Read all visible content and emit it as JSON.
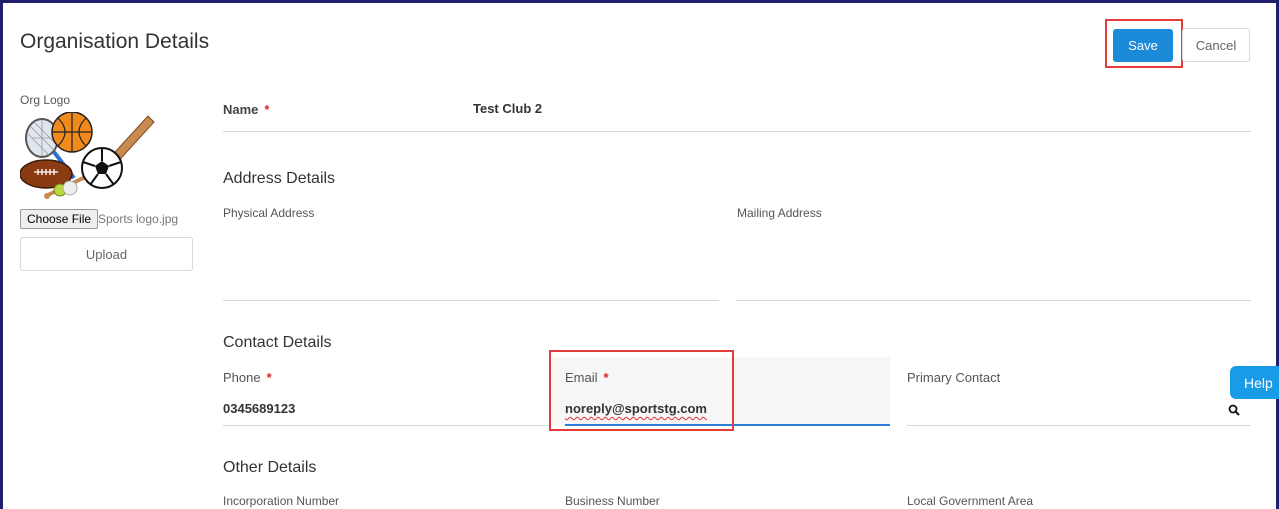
{
  "header": {
    "title": "Organisation Details",
    "save_label": "Save",
    "cancel_label": "Cancel"
  },
  "logo": {
    "label": "Org Logo",
    "choose_file_label": "Choose File",
    "file_name": "Sports logo.jpg",
    "upload_label": "Upload"
  },
  "name": {
    "label": "Name",
    "required_mark": "*",
    "value": "Test Club 2"
  },
  "address": {
    "section_title": "Address Details",
    "physical_label": "Physical Address",
    "mailing_label": "Mailing Address"
  },
  "contact": {
    "section_title": "Contact Details",
    "phone_label": "Phone",
    "phone_required": "*",
    "phone_value": "0345689123",
    "email_label": "Email",
    "email_required": "*",
    "email_value": "noreply@sportstg.com",
    "primary_label": "Primary Contact"
  },
  "other": {
    "section_title": "Other Details",
    "incorporation_label": "Incorporation Number",
    "business_label": "Business Number",
    "lga_label": "Local Government Area"
  },
  "help_label": "Help",
  "colors": {
    "accent": "#1a8ad9",
    "required": "#d9262b",
    "highlight": "#e53b3b",
    "help": "#1a9be8"
  }
}
